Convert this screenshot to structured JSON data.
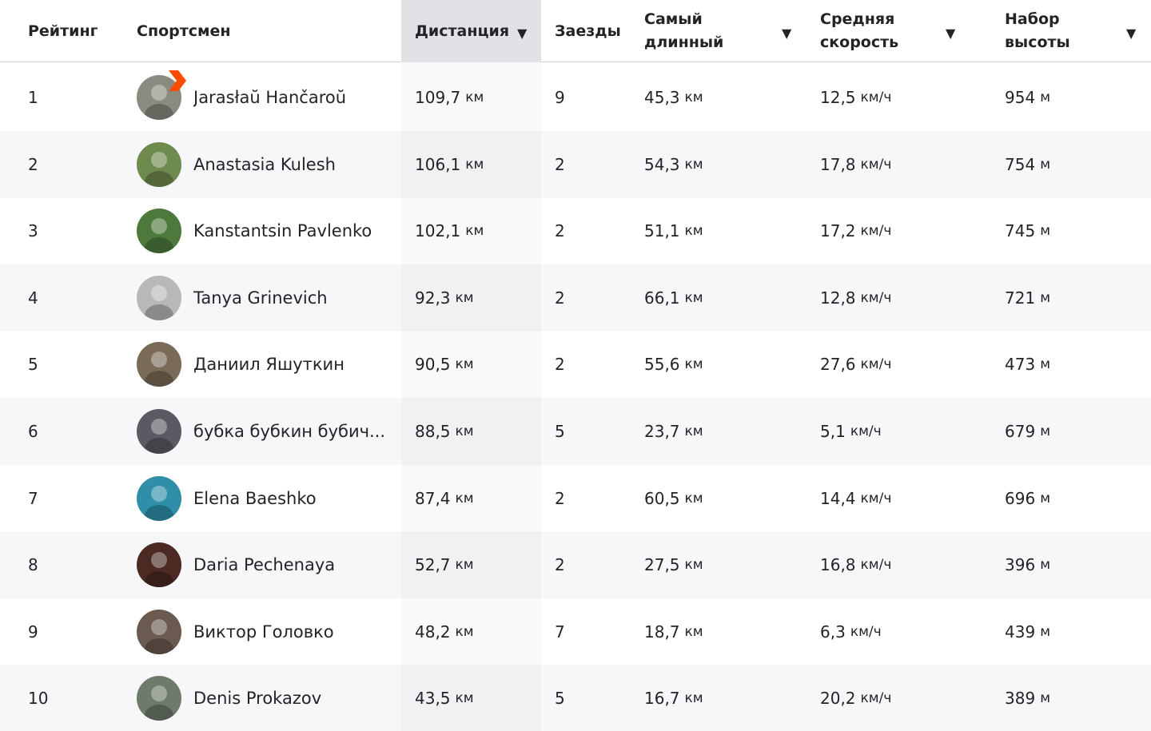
{
  "headers": {
    "rank": "Рейтинг",
    "athlete": "Спортсмен",
    "distance": "Дистанция",
    "rides": "Заезды",
    "longest": "Самый длинный",
    "avg_speed": "Средняя скорость",
    "elevation": "Набор высоты",
    "sort_arrow": "▼"
  },
  "units": {
    "km": "км",
    "kmh": "км/ч",
    "m": "м"
  },
  "rows": [
    {
      "rank": "1",
      "name": "Jarasłaŭ Hančaroŭ",
      "distance": "109,7",
      "rides": "9",
      "longest": "45,3",
      "avg_speed": "12,5",
      "elevation": "954",
      "avatar_color": "#8a8a80",
      "has_badge": true
    },
    {
      "rank": "2",
      "name": "Anastasia Kulesh",
      "distance": "106,1",
      "rides": "2",
      "longest": "54,3",
      "avg_speed": "17,8",
      "elevation": "754",
      "avatar_color": "#6f8a4e",
      "has_badge": false
    },
    {
      "rank": "3",
      "name": "Kanstantsin Pavlenko",
      "distance": "102,1",
      "rides": "2",
      "longest": "51,1",
      "avg_speed": "17,2",
      "elevation": "745",
      "avatar_color": "#4d7a3c",
      "has_badge": false
    },
    {
      "rank": "4",
      "name": "Tanya Grinevich",
      "distance": "92,3",
      "rides": "2",
      "longest": "66,1",
      "avg_speed": "12,8",
      "elevation": "721",
      "avatar_color": "#b8b8b8",
      "has_badge": false
    },
    {
      "rank": "5",
      "name": "Даниил Яшуткин",
      "distance": "90,5",
      "rides": "2",
      "longest": "55,6",
      "avg_speed": "27,6",
      "elevation": "473",
      "avatar_color": "#7a6a58",
      "has_badge": false
    },
    {
      "rank": "6",
      "name": "бубка бубкин бубич...",
      "distance": "88,5",
      "rides": "5",
      "longest": "23,7",
      "avg_speed": "5,1",
      "elevation": "679",
      "avatar_color": "#5a5a62",
      "has_badge": false
    },
    {
      "rank": "7",
      "name": "Elena Baeshko",
      "distance": "87,4",
      "rides": "2",
      "longest": "60,5",
      "avg_speed": "14,4",
      "elevation": "696",
      "avatar_color": "#2f8fa8",
      "has_badge": false
    },
    {
      "rank": "8",
      "name": "Daria Pechenaya",
      "distance": "52,7",
      "rides": "2",
      "longest": "27,5",
      "avg_speed": "16,8",
      "elevation": "396",
      "avatar_color": "#4a2a22",
      "has_badge": false
    },
    {
      "rank": "9",
      "name": "Виктор Головко",
      "distance": "48,2",
      "rides": "7",
      "longest": "18,7",
      "avg_speed": "6,3",
      "elevation": "439",
      "avatar_color": "#6a5a50",
      "has_badge": false
    },
    {
      "rank": "10",
      "name": "Denis Prokazov",
      "distance": "43,5",
      "rides": "5",
      "longest": "16,7",
      "avg_speed": "20,2",
      "elevation": "389",
      "avatar_color": "#6e7a6a",
      "has_badge": false
    }
  ],
  "colors": {
    "badge": "#fc4c02",
    "text": "#242428",
    "header_active_bg": "#e2e2e6",
    "alt_row_bg": "#f7f7fa"
  }
}
